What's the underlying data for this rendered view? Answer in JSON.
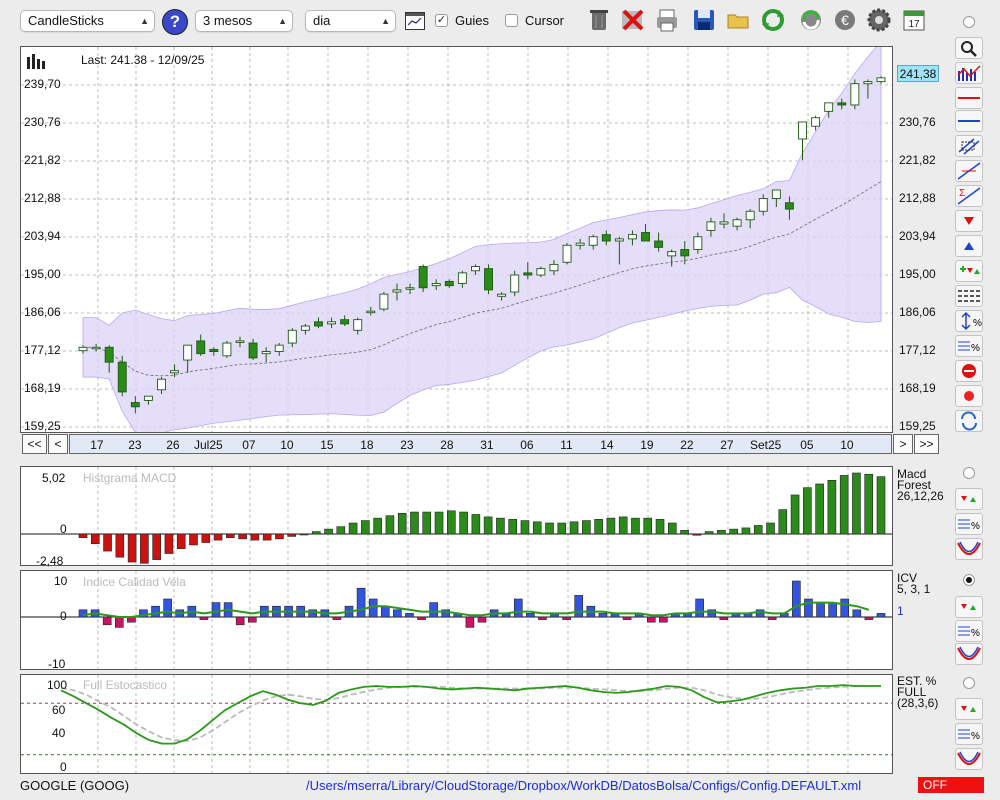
{
  "toolbar": {
    "chart_type": "CandleSticks",
    "period": "3 mesos",
    "interval": "dia",
    "guides_label": "Guies",
    "guides_checked": true,
    "cursor_label": "Cursor",
    "cursor_checked": false,
    "icons": [
      "help-icon",
      "chart-window-icon",
      "trash-icon",
      "delete-icon",
      "print-icon",
      "save-icon",
      "folder-icon",
      "refresh-icon",
      "sync-icon",
      "currency-icon",
      "settings-icon",
      "calendar-icon"
    ]
  },
  "main_chart": {
    "info": "Last: 241.38 - 12/09/25",
    "last_price_badge": "241,38",
    "y_labels": [
      "239,70",
      "230,76",
      "221,82",
      "212,88",
      "203,94",
      "195,00",
      "186,06",
      "177,12",
      "168,19",
      "159,25"
    ],
    "x_labels": [
      "17",
      "23",
      "26",
      "Jul25",
      "07",
      "10",
      "15",
      "18",
      "23",
      "28",
      "31",
      "06",
      "11",
      "14",
      "19",
      "22",
      "27",
      "Set25",
      "05",
      "10"
    ],
    "nav": {
      "first": "<<",
      "prev": "<",
      "next": ">",
      "last": ">>"
    }
  },
  "chart_data": [
    {
      "type": "candlestick",
      "title": "Last: 241.38 - 12/09/25",
      "ylim": [
        159.25,
        239.7
      ],
      "yticks": [
        239.7,
        230.76,
        221.82,
        212.88,
        203.94,
        195.0,
        186.06,
        177.12,
        168.19,
        159.25
      ],
      "candles": [
        {
          "o": 177.2,
          "h": 178.5,
          "l": 176.5,
          "c": 178.0
        },
        {
          "o": 177.8,
          "h": 178.8,
          "l": 177.0,
          "c": 178.0
        },
        {
          "o": 178.0,
          "h": 178.5,
          "l": 172.0,
          "c": 174.5
        },
        {
          "o": 174.5,
          "h": 176.0,
          "l": 166.5,
          "c": 167.5
        },
        {
          "o": 165.0,
          "h": 166.5,
          "l": 162.5,
          "c": 164.0
        },
        {
          "o": 165.5,
          "h": 166.5,
          "l": 164.5,
          "c": 166.5
        },
        {
          "o": 168.0,
          "h": 171.0,
          "l": 167.0,
          "c": 170.5
        },
        {
          "o": 172.0,
          "h": 174.0,
          "l": 171.0,
          "c": 172.5
        },
        {
          "o": 175.0,
          "h": 178.5,
          "l": 172.0,
          "c": 178.5
        },
        {
          "o": 179.5,
          "h": 181.0,
          "l": 176.0,
          "c": 176.5
        },
        {
          "o": 177.5,
          "h": 178.0,
          "l": 176.0,
          "c": 177.0
        },
        {
          "o": 176.0,
          "h": 179.5,
          "l": 175.5,
          "c": 179.0
        },
        {
          "o": 179.5,
          "h": 180.5,
          "l": 178.0,
          "c": 179.5
        },
        {
          "o": 179.0,
          "h": 180.0,
          "l": 175.0,
          "c": 175.5
        },
        {
          "o": 176.5,
          "h": 178.0,
          "l": 174.5,
          "c": 177.0
        },
        {
          "o": 177.0,
          "h": 179.0,
          "l": 176.0,
          "c": 178.5
        },
        {
          "o": 179.0,
          "h": 182.5,
          "l": 178.0,
          "c": 182.0
        },
        {
          "o": 182.0,
          "h": 183.5,
          "l": 181.0,
          "c": 183.0
        },
        {
          "o": 184.0,
          "h": 185.0,
          "l": 182.5,
          "c": 183.0
        },
        {
          "o": 183.5,
          "h": 185.0,
          "l": 182.5,
          "c": 184.0
        },
        {
          "o": 184.5,
          "h": 185.5,
          "l": 183.0,
          "c": 183.5
        },
        {
          "o": 182.0,
          "h": 185.0,
          "l": 181.0,
          "c": 184.5
        },
        {
          "o": 186.5,
          "h": 187.5,
          "l": 185.5,
          "c": 186.5
        },
        {
          "o": 187.0,
          "h": 191.0,
          "l": 186.5,
          "c": 190.5
        },
        {
          "o": 191.0,
          "h": 193.0,
          "l": 189.0,
          "c": 191.5
        },
        {
          "o": 192.0,
          "h": 193.0,
          "l": 190.5,
          "c": 192.0
        },
        {
          "o": 197.0,
          "h": 197.5,
          "l": 191.0,
          "c": 192.0
        },
        {
          "o": 192.5,
          "h": 194.0,
          "l": 191.5,
          "c": 193.0
        },
        {
          "o": 193.5,
          "h": 194.0,
          "l": 192.0,
          "c": 192.5
        },
        {
          "o": 193.0,
          "h": 196.0,
          "l": 192.0,
          "c": 195.5
        },
        {
          "o": 196.0,
          "h": 197.5,
          "l": 195.0,
          "c": 197.0
        },
        {
          "o": 196.5,
          "h": 197.5,
          "l": 190.5,
          "c": 191.5
        },
        {
          "o": 190.0,
          "h": 191.0,
          "l": 189.0,
          "c": 190.5
        },
        {
          "o": 191.0,
          "h": 196.0,
          "l": 190.0,
          "c": 195.0
        },
        {
          "o": 195.5,
          "h": 198.0,
          "l": 194.0,
          "c": 195.0
        },
        {
          "o": 195.0,
          "h": 197.0,
          "l": 194.5,
          "c": 196.5
        },
        {
          "o": 196.0,
          "h": 198.5,
          "l": 195.0,
          "c": 197.5
        },
        {
          "o": 198.0,
          "h": 202.5,
          "l": 197.5,
          "c": 202.0
        },
        {
          "o": 202.0,
          "h": 203.5,
          "l": 201.0,
          "c": 202.5
        },
        {
          "o": 202.0,
          "h": 204.5,
          "l": 201.0,
          "c": 204.0
        },
        {
          "o": 204.5,
          "h": 205.5,
          "l": 202.0,
          "c": 203.0
        },
        {
          "o": 203.0,
          "h": 204.0,
          "l": 197.5,
          "c": 203.5
        },
        {
          "o": 203.5,
          "h": 205.5,
          "l": 202.0,
          "c": 204.5
        },
        {
          "o": 205.0,
          "h": 207.0,
          "l": 203.5,
          "c": 203.0
        },
        {
          "o": 203.0,
          "h": 205.0,
          "l": 200.5,
          "c": 201.5
        },
        {
          "o": 199.5,
          "h": 201.0,
          "l": 197.0,
          "c": 200.5
        },
        {
          "o": 201.0,
          "h": 203.0,
          "l": 197.5,
          "c": 199.5
        },
        {
          "o": 201.0,
          "h": 205.0,
          "l": 200.0,
          "c": 204.0
        },
        {
          "o": 205.5,
          "h": 208.5,
          "l": 204.0,
          "c": 207.5
        },
        {
          "o": 207.0,
          "h": 209.5,
          "l": 206.0,
          "c": 207.5
        },
        {
          "o": 206.5,
          "h": 208.5,
          "l": 205.5,
          "c": 208.0
        },
        {
          "o": 208.0,
          "h": 210.5,
          "l": 206.0,
          "c": 210.0
        },
        {
          "o": 210.0,
          "h": 214.0,
          "l": 209.0,
          "c": 213.0
        },
        {
          "o": 213.0,
          "h": 215.0,
          "l": 211.0,
          "c": 215.0
        },
        {
          "o": 212.0,
          "h": 213.5,
          "l": 208.0,
          "c": 210.5
        },
        {
          "o": 227.0,
          "h": 228.0,
          "l": 222.0,
          "c": 231.0
        },
        {
          "o": 230.0,
          "h": 232.5,
          "l": 229.0,
          "c": 232.0
        },
        {
          "o": 233.5,
          "h": 235.5,
          "l": 232.0,
          "c": 235.5
        },
        {
          "o": 235.5,
          "h": 236.5,
          "l": 234.0,
          "c": 235.0
        },
        {
          "o": 235.0,
          "h": 241.0,
          "l": 234.0,
          "c": 240.0
        },
        {
          "o": 240.0,
          "h": 241.0,
          "l": 236.5,
          "c": 240.5
        },
        {
          "o": 240.5,
          "h": 241.8,
          "l": 240.0,
          "c": 241.38
        }
      ]
    },
    {
      "type": "bar",
      "title": "Histgrama MACD",
      "legend": [
        "Macd",
        "Forest",
        "26,12,26"
      ],
      "ylim": [
        -2.48,
        5.02
      ],
      "yticks": [
        "5,02",
        "0",
        "-2,48"
      ],
      "values": [
        -0.3,
        -0.8,
        -1.4,
        -1.9,
        -2.3,
        -2.4,
        -2.1,
        -1.6,
        -1.2,
        -0.9,
        -0.7,
        -0.5,
        -0.3,
        -0.4,
        -0.5,
        -0.5,
        -0.4,
        -0.2,
        0,
        0.2,
        0.4,
        0.6,
        0.9,
        1.1,
        1.3,
        1.5,
        1.7,
        1.8,
        1.8,
        1.8,
        1.9,
        1.8,
        1.6,
        1.4,
        1.3,
        1.2,
        1.1,
        1.0,
        0.9,
        0.9,
        1.0,
        1.1,
        1.2,
        1.3,
        1.4,
        1.3,
        1.3,
        1.2,
        0.9,
        0.3,
        -0.1,
        0.2,
        0.3,
        0.4,
        0.5,
        0.7,
        0.9,
        2.0,
        3.2,
        3.8,
        4.1,
        4.4,
        4.8,
        5.0,
        4.9,
        4.7
      ]
    },
    {
      "type": "bar",
      "title": "Indice Calidad Vela",
      "legend": [
        "ICV",
        "5, 3, 1",
        "1"
      ],
      "ylim": [
        -10,
        10
      ],
      "yticks": [
        "10",
        "0",
        "-10"
      ],
      "values": [
        2,
        2,
        -3,
        -4,
        -2,
        2,
        3,
        5,
        2,
        3,
        -1,
        4,
        4,
        -3,
        -2,
        3,
        3,
        3,
        3,
        2,
        2,
        -1,
        3,
        8,
        5,
        3,
        2,
        1,
        -1,
        4,
        2,
        1,
        -4,
        -2,
        2,
        1,
        5,
        1,
        -1,
        1,
        -1,
        6,
        3,
        1,
        1,
        -1,
        1,
        -2,
        -2,
        1,
        1,
        5,
        2,
        -1,
        1,
        1,
        2,
        -1,
        1,
        10,
        5,
        4,
        4,
        5,
        2,
        -1,
        1
      ],
      "line": [
        0.5,
        1,
        0.5,
        0,
        0,
        0.5,
        1,
        1.5,
        1,
        1.5,
        1,
        1.5,
        2,
        1.5,
        1,
        1.5,
        1.5,
        1.5,
        1.5,
        1.5,
        1,
        1,
        1.5,
        2,
        3,
        3,
        2.5,
        2,
        1.5,
        1.5,
        1.5,
        1,
        0.5,
        0.5,
        1,
        1,
        1.5,
        1.5,
        1,
        1,
        1,
        1.5,
        1.5,
        1.5,
        1,
        1,
        1,
        0.5,
        0.5,
        1,
        1,
        1.5,
        1.5,
        1,
        1,
        1,
        1.5,
        1,
        1,
        3,
        4,
        4,
        4,
        3.5,
        3,
        2
      ]
    },
    {
      "type": "line",
      "title": "Full Estocastico",
      "legend": [
        "EST. %",
        "FULL",
        "(28,3,6)"
      ],
      "ylim": [
        0,
        100
      ],
      "yticks": [
        "100",
        "60",
        "40",
        "0"
      ],
      "series": [
        {
          "name": "K",
          "values": [
            95,
            88,
            80,
            72,
            63,
            55,
            45,
            37,
            33,
            33,
            38,
            48,
            60,
            72,
            80,
            88,
            94,
            90,
            84,
            80,
            78,
            83,
            92,
            96,
            99,
            100,
            99,
            99,
            100,
            99,
            97,
            96,
            97,
            98,
            97,
            96,
            95,
            97,
            98,
            99,
            100,
            98,
            95,
            93,
            92,
            93,
            95,
            97,
            100,
            99,
            95,
            87,
            81,
            82,
            84,
            88,
            92,
            95,
            97,
            98,
            100,
            100,
            101,
            100,
            100,
            100
          ]
        },
        {
          "name": "D",
          "values": [
            98,
            95,
            90,
            82,
            75,
            65,
            55,
            47,
            40,
            37,
            36,
            40,
            48,
            58,
            68,
            76,
            83,
            88,
            90,
            88,
            85,
            84,
            86,
            90,
            93,
            96,
            98,
            99,
            99,
            99,
            99,
            98,
            97,
            97,
            97,
            97,
            97,
            97,
            97,
            98,
            98,
            98,
            97,
            96,
            95,
            94,
            94,
            95,
            97,
            98,
            98,
            95,
            90,
            87,
            85,
            85,
            87,
            90,
            93,
            95,
            97,
            98,
            99,
            100,
            100,
            100
          ]
        }
      ]
    }
  ],
  "macd_panel": {
    "title": "Histgrama MACD",
    "y_labels": [
      "5,02",
      "0",
      "-2,48"
    ],
    "legend": [
      "Macd",
      "Forest",
      "26,12,26"
    ]
  },
  "icv_panel": {
    "title": "Indice Calidad Vela",
    "y_labels": [
      "10",
      "0",
      "-10"
    ],
    "legend": [
      "ICV",
      "5, 3, 1"
    ],
    "legend_value": "1"
  },
  "stoch_panel": {
    "title": "Full Estocastico",
    "y_labels": [
      "100",
      "60",
      "40",
      "0"
    ],
    "legend": [
      "EST. %",
      "FULL",
      "(28,3,6)"
    ]
  },
  "status": {
    "ticker": "GOOGLE (GOOG)",
    "path": "/Users/mserra/Library/CloudStorage/Dropbox/WorkDB/DatosBolsa/Configs/Config.DEFAULT.xml",
    "indicator": "OFF"
  },
  "colors": {
    "up": "#2a8a1a",
    "down": "#cc1111",
    "blue_bar": "#3355dd",
    "band": "#dcd3f7",
    "badge": "#9fe3f7",
    "off": "#ee1111"
  }
}
